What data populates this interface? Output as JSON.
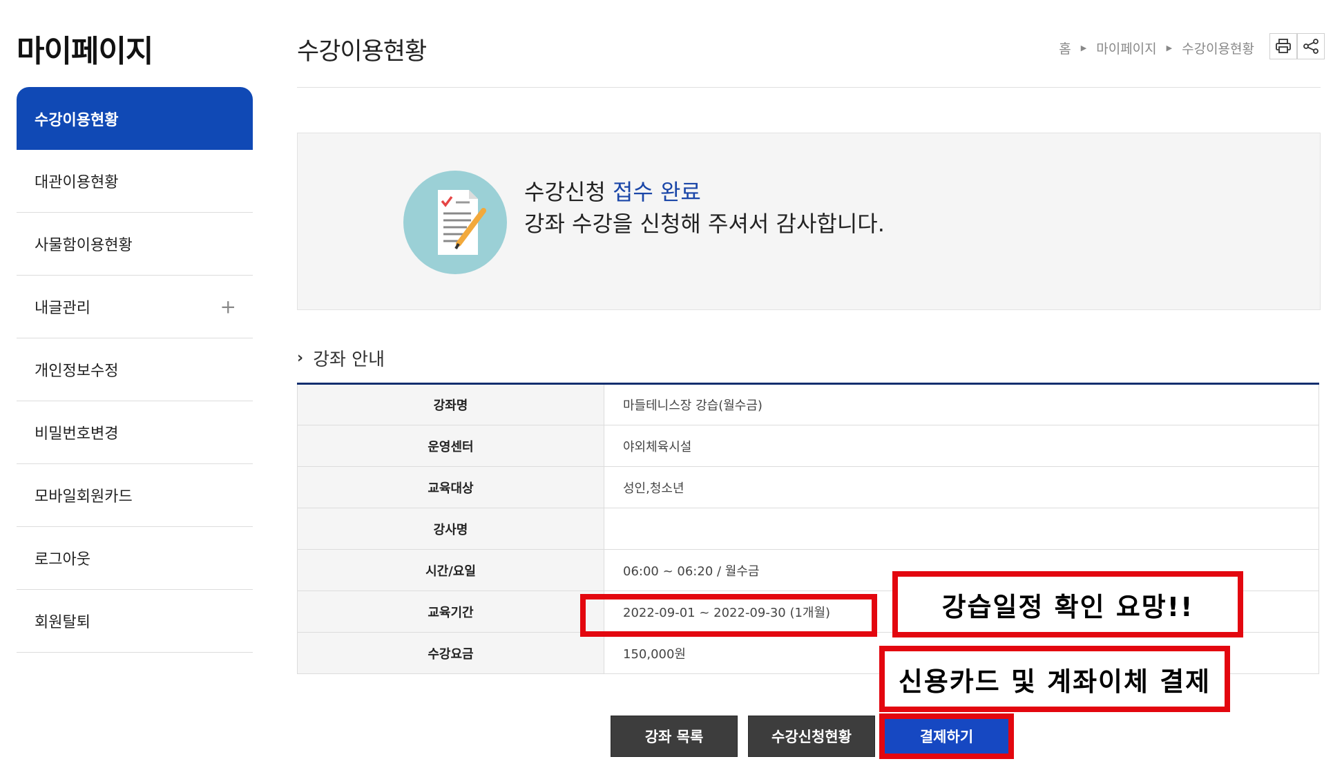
{
  "sidebar": {
    "title": "마이페이지",
    "items": [
      {
        "label": "수강이용현황"
      },
      {
        "label": "대관이용현황"
      },
      {
        "label": "사물함이용현황"
      },
      {
        "label": "내글관리",
        "expand": "+"
      },
      {
        "label": "개인정보수정"
      },
      {
        "label": "비밀번호변경"
      },
      {
        "label": "모바일회원카드"
      },
      {
        "label": "로그아웃"
      },
      {
        "label": "회원탈퇴"
      }
    ]
  },
  "header": {
    "title": "수강이용현황",
    "breadcrumb": [
      "홈",
      "마이페이지",
      "수강이용현황"
    ],
    "tools": [
      {
        "icon": "print-icon"
      },
      {
        "icon": "share-icon"
      }
    ]
  },
  "completion": {
    "line1_prefix": "수강신청",
    "line1_highlight": "접수 완료",
    "line2": "강좌 수강을 신청해 주셔서 감사합니다.",
    "highlight_color": "#1a46a8",
    "icon": "document-checklist-icon"
  },
  "section": {
    "title": "강좌 안내",
    "rows": [
      {
        "label": "강좌명",
        "value": "마들테니스장 강습(월수금)"
      },
      {
        "label": "운영센터",
        "value": "야외체육시설"
      },
      {
        "label": "교육대상",
        "value": "성인,청소년"
      },
      {
        "label": "강사명",
        "value": ""
      },
      {
        "label": "시간/요일",
        "value": "06:00 ~ 06:20 / 월수금"
      },
      {
        "label": "교육기간",
        "value": "2022-09-01 ~ 2022-09-30 (1개월)"
      },
      {
        "label": "수강요금",
        "value": "150,000원"
      }
    ]
  },
  "annotations": {
    "note1": "강습일정 확인 요망!!",
    "note2": "신용카드 및 계좌이체 결제",
    "color": "#e3070f"
  },
  "buttons": {
    "list": "강좌 목록",
    "status": "수강신청현황",
    "pay": "결제하기"
  },
  "colors": {
    "primary": "#1049b5",
    "table_border": "#0f2e6e"
  }
}
